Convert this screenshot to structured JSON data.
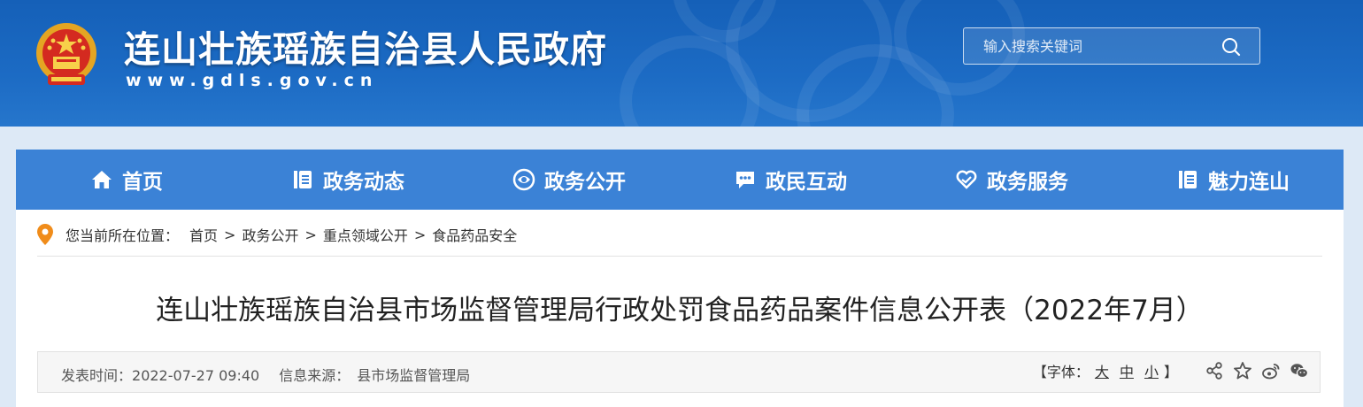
{
  "header": {
    "site_title": "连山壮族瑶族自治县人民政府",
    "site_url": "www.gdls.gov.cn",
    "search_placeholder": "输入搜索关键词",
    "colors": {
      "banner": "#1c6bc4",
      "nav": "#3b82d6",
      "page_bg": "#dde9f6"
    }
  },
  "nav": {
    "items": [
      {
        "label": "首页",
        "icon": "home-icon"
      },
      {
        "label": "政务动态",
        "icon": "document-list-icon"
      },
      {
        "label": "政务公开",
        "icon": "eye-icon"
      },
      {
        "label": "政民互动",
        "icon": "chat-icon"
      },
      {
        "label": "政务服务",
        "icon": "heart-hands-icon"
      },
      {
        "label": "魅力连山",
        "icon": "document-list-icon"
      }
    ]
  },
  "breadcrumb": {
    "prefix": "您当前所在位置：",
    "items": [
      "首页",
      "政务公开",
      "重点领域公开",
      "食品药品安全"
    ],
    "separator": ">"
  },
  "article": {
    "title": "连山壮族瑶族自治县市场监督管理局行政处罚食品药品案件信息公开表（2022年7月）",
    "publish_label": "发表时间：",
    "publish_time": "2022-07-27 09:40",
    "source_label": "信息来源：",
    "source": "县市场监督管理局",
    "font_label_open": "【字体：",
    "font_large": "大",
    "font_medium": "中",
    "font_small": "小",
    "font_label_close": "】",
    "share_icons": [
      "share-icon",
      "star-icon",
      "weibo-icon",
      "wechat-icon"
    ]
  }
}
